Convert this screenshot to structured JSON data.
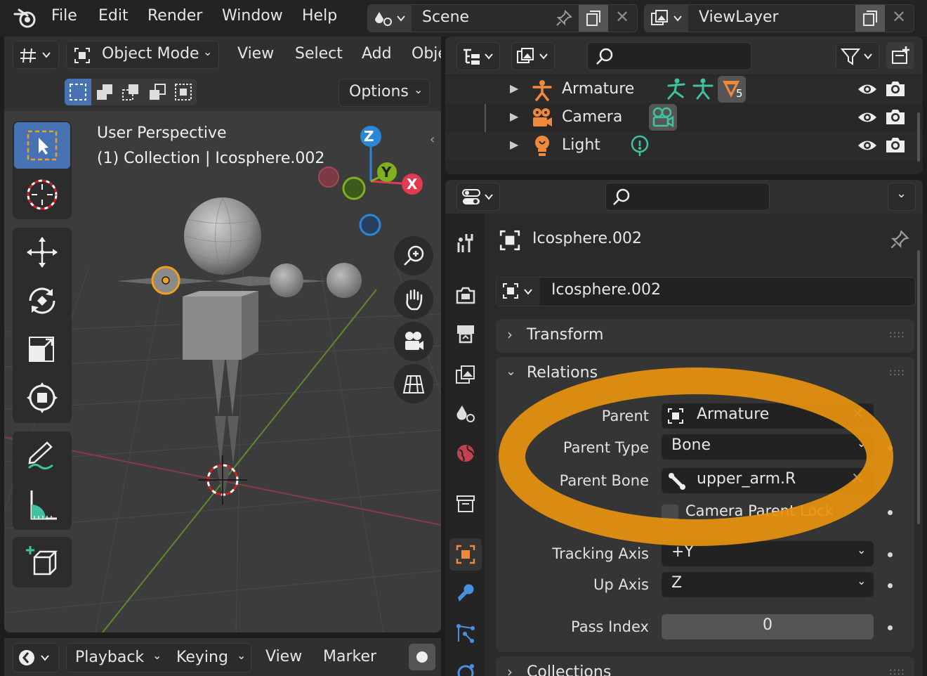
{
  "topbar": {
    "menus": [
      "File",
      "Edit",
      "Render",
      "Window",
      "Help"
    ],
    "scene_label": "Scene",
    "viewlayer_label": "ViewLayer"
  },
  "viewport": {
    "mode_label": "Object Mode",
    "menus": [
      "View",
      "Select",
      "Add",
      "Obje"
    ],
    "options_label": "Options",
    "overlay_line1": "User Perspective",
    "overlay_line2": "(1) Collection | Icosphere.002",
    "gizmo": {
      "z": "Z",
      "y": "Y",
      "x": "X"
    }
  },
  "timeline": {
    "menus": [
      "Playback",
      "Keying",
      "View",
      "Marker"
    ]
  },
  "outliner": {
    "rows": [
      {
        "name": "Armature",
        "badge": "5"
      },
      {
        "name": "Camera"
      },
      {
        "name": "Light"
      }
    ]
  },
  "properties": {
    "object_name": "Icosphere.002",
    "datablock_name": "Icosphere.002",
    "panels": {
      "transform": "Transform",
      "relations": "Relations",
      "collections": "Collections"
    },
    "relations": {
      "parent_label": "Parent",
      "parent_value": "Armature",
      "parent_type_label": "Parent Type",
      "parent_type_value": "Bone",
      "parent_bone_label": "Parent Bone",
      "parent_bone_value": "upper_arm.R",
      "camera_lock_label": "Camera Parent Lock",
      "tracking_axis_label": "Tracking Axis",
      "tracking_axis_value": "+Y",
      "up_axis_label": "Up Axis",
      "up_axis_value": "Z",
      "pass_index_label": "Pass Index",
      "pass_index_value": "0"
    }
  },
  "colors": {
    "highlight_ring": "#e8940f",
    "selected_tool": "#4772b3",
    "axis_x": "#e23a4e",
    "axis_y": "#7fb01e",
    "axis_z": "#2c86d8"
  }
}
